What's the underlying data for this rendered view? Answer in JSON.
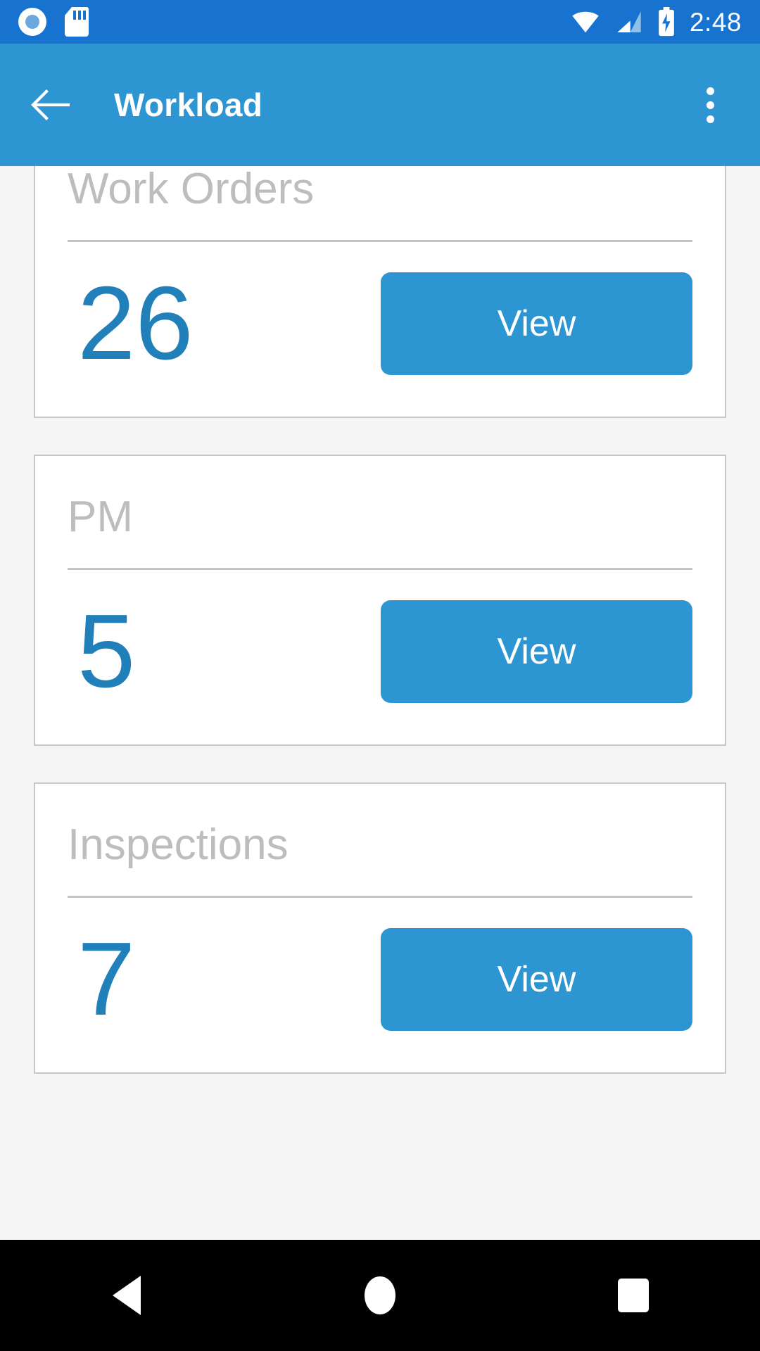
{
  "status_bar": {
    "background_color": "#1773cf",
    "time": "2:48",
    "left_icons": [
      {
        "name": "screen-record-icon"
      },
      {
        "name": "sd-card-icon"
      }
    ],
    "right_icons": [
      {
        "name": "wifi-icon"
      },
      {
        "name": "cellular-signal-icon"
      },
      {
        "name": "battery-charging-icon"
      }
    ]
  },
  "app_bar": {
    "background_color": "#2e95d3",
    "title": "Workload",
    "back_icon": "arrow-back-icon",
    "overflow_icon": "more-vertical-icon"
  },
  "theme": {
    "page_background": "#f5f5f5",
    "card_background": "#ffffff",
    "card_border": "#c7c7c7",
    "title_color": "#bdbdbd",
    "count_color": "#2180b9",
    "button_color": "#2e95d3",
    "button_text_color": "#ffffff"
  },
  "cards": [
    {
      "title": "Work Orders",
      "count": "26",
      "action_label": "View"
    },
    {
      "title": "PM",
      "count": "5",
      "action_label": "View"
    },
    {
      "title": "Inspections",
      "count": "7",
      "action_label": "View"
    }
  ],
  "nav_bar": {
    "background_color": "#000000",
    "buttons": [
      {
        "name": "nav-back-button",
        "icon": "triangle-back-icon"
      },
      {
        "name": "nav-home-button",
        "icon": "circle-home-icon"
      },
      {
        "name": "nav-recents-button",
        "icon": "square-recents-icon"
      }
    ]
  }
}
